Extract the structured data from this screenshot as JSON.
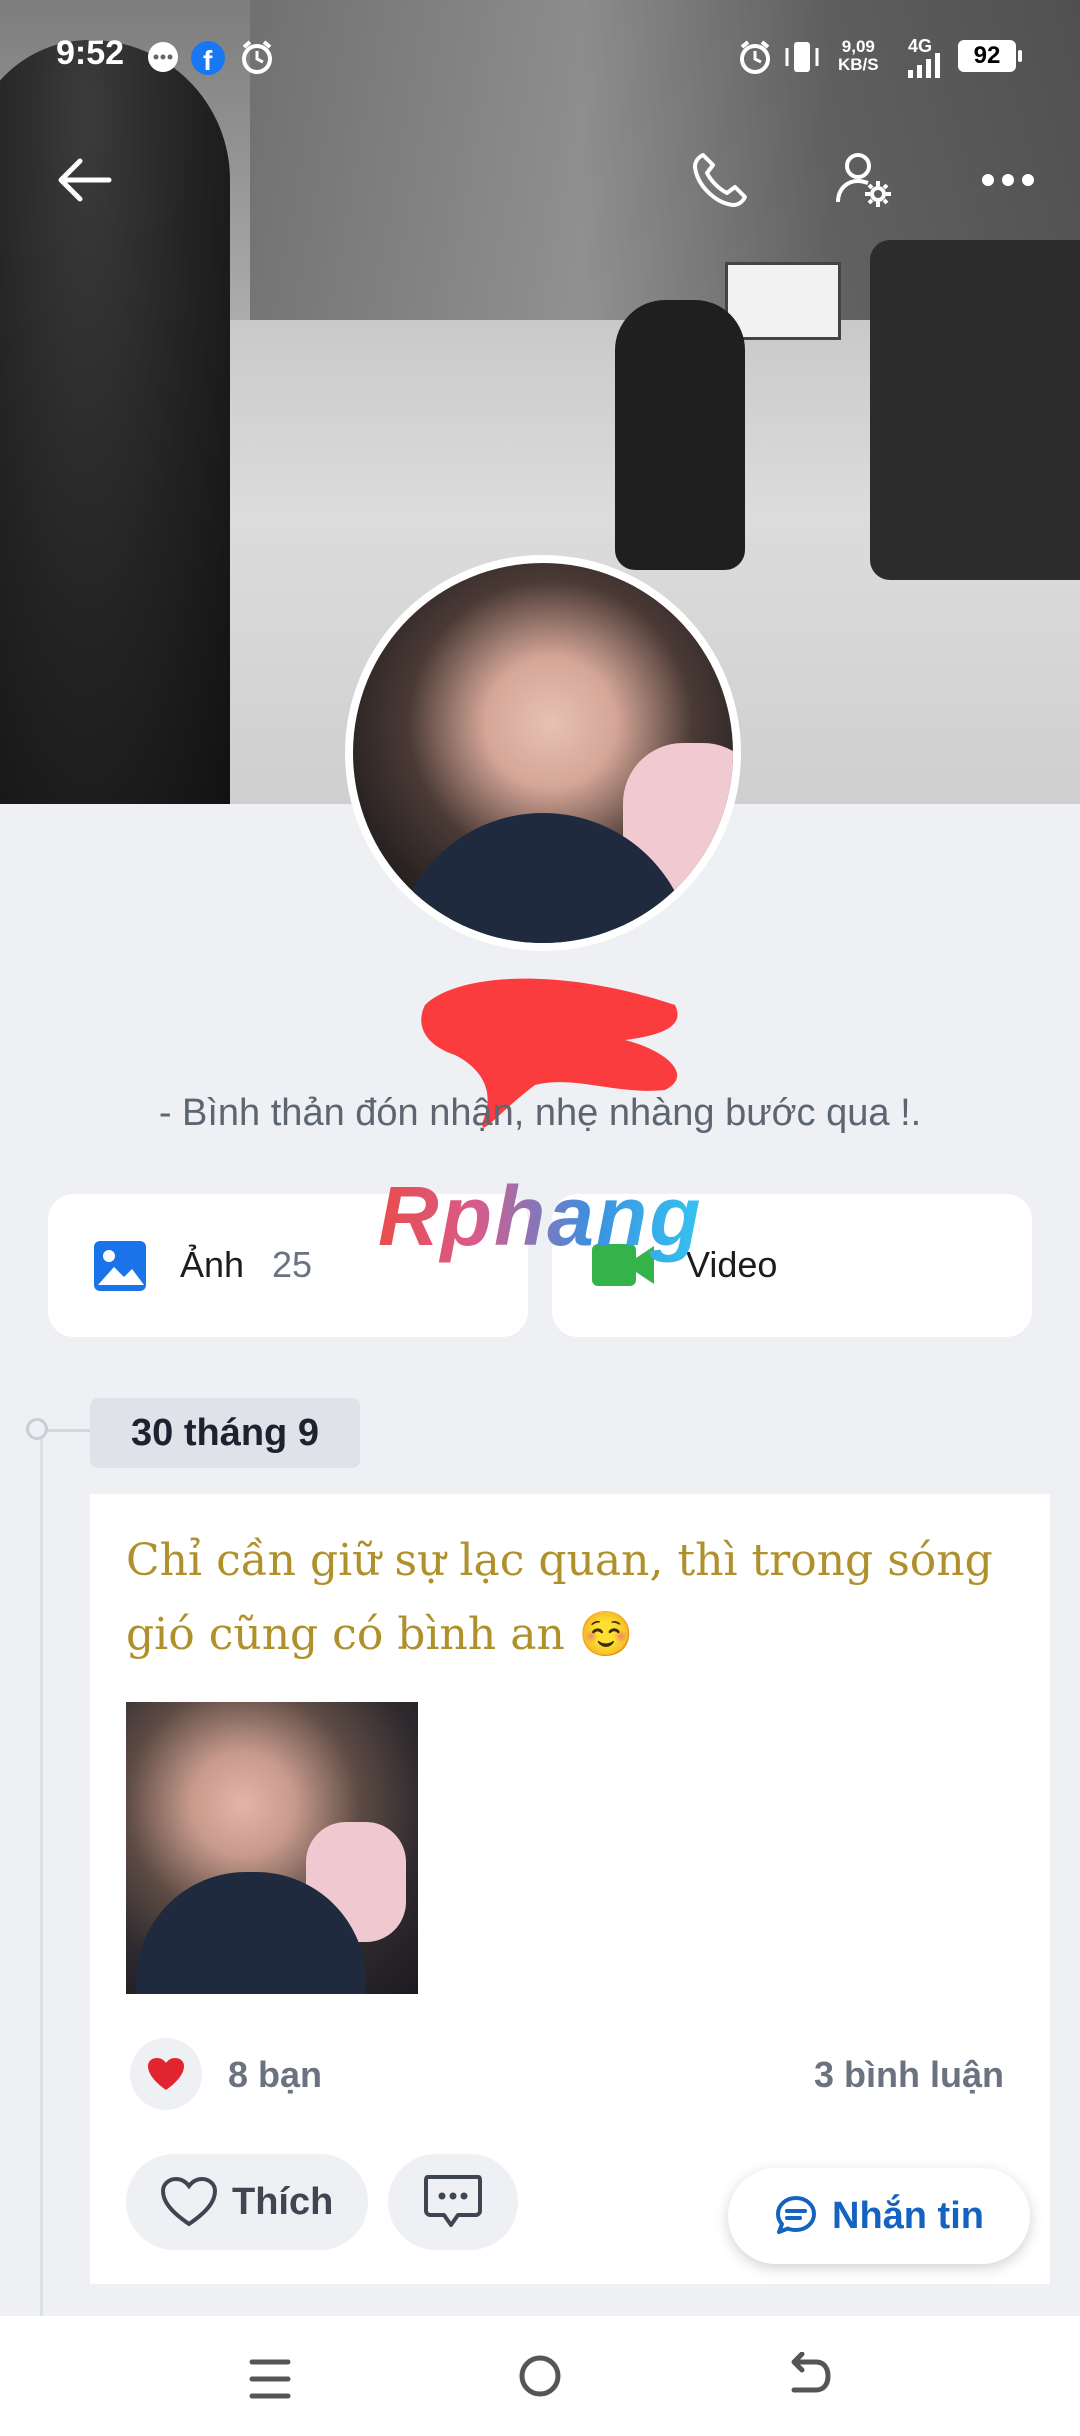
{
  "status_bar": {
    "time": "9:52",
    "speed": "9,09",
    "speed_unit": "KB/S",
    "network": "4G",
    "battery": "92"
  },
  "profile": {
    "bio": "- Bình thản đón nhận, nhẹ nhàng bước qua !.",
    "watermark": "Rphang"
  },
  "media": {
    "photos_label": "Ảnh",
    "photos_count": "25",
    "video_label": "Video"
  },
  "timeline": {
    "date": "30 tháng 9"
  },
  "post": {
    "text": "Chỉ cần giữ sự lạc quan, thì trong sóng gió cũng có bình an ☺️",
    "likes": "8 bạn",
    "comments": "3 bình luận",
    "like_button": "Thích"
  },
  "message_button": "Nhắn tin",
  "icons": {
    "back": "back-arrow-icon",
    "call": "phone-icon",
    "settings": "profile-settings-icon",
    "more": "more-icon"
  },
  "colors": {
    "post_text": "#b0902a",
    "accent_blue": "#1563c0",
    "video_green": "#34b34a",
    "heart_red": "#e0252f"
  }
}
